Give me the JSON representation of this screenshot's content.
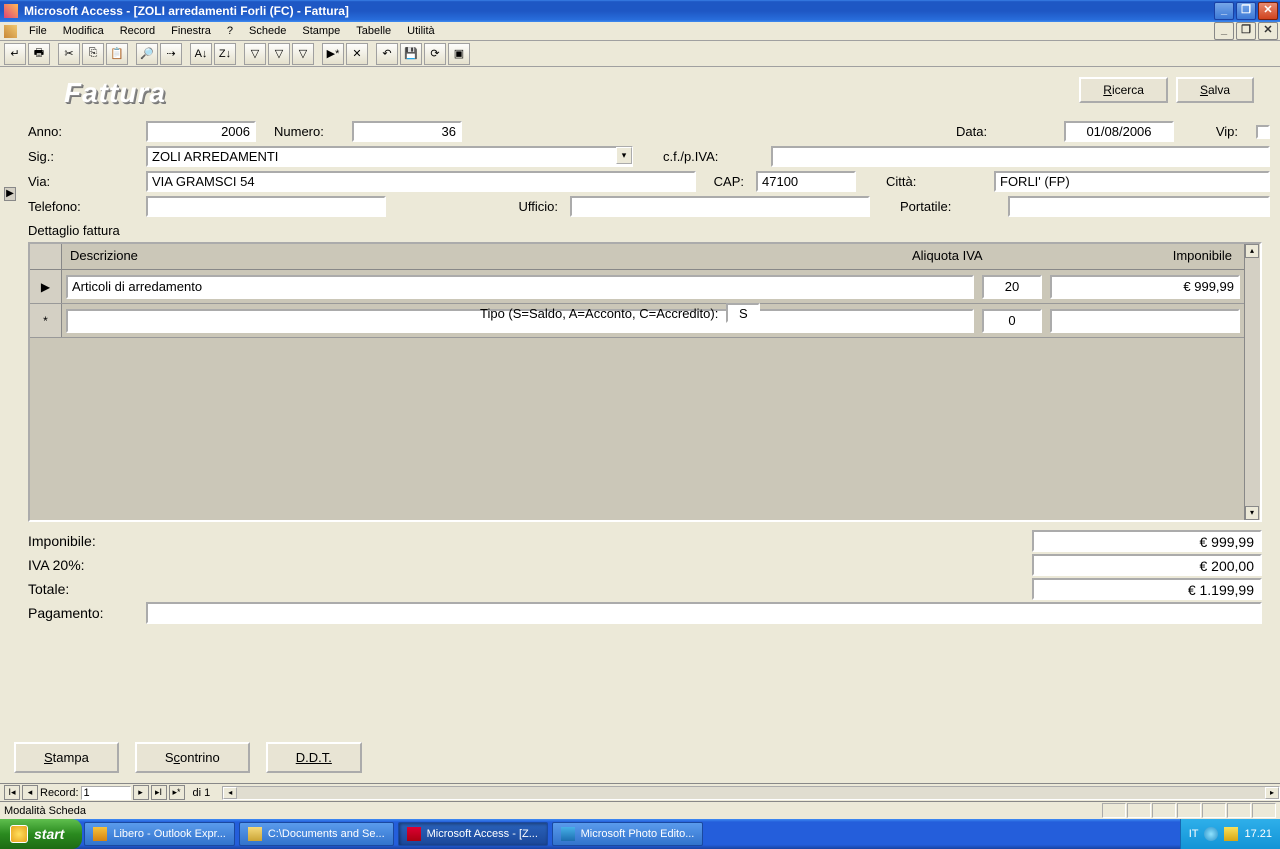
{
  "title": "Microsoft Access - [ZOLI arredamenti Forli (FC) - Fattura]",
  "menu": [
    "File",
    "Modifica",
    "Record",
    "Finestra",
    "?",
    "Schede",
    "Stampe",
    "Tabelle",
    "Utilità"
  ],
  "form": {
    "title": "Fattura",
    "buttons": {
      "ricerca": "Ricerca",
      "salva": "Salva"
    },
    "labels": {
      "anno": "Anno:",
      "numero": "Numero:",
      "data": "Data:",
      "vip": "Vip:",
      "sig": "Sig.:",
      "cfpiva": "c.f./p.IVA:",
      "via": "Via:",
      "cap": "CAP:",
      "citta": "Città:",
      "telefono": "Telefono:",
      "ufficio": "Ufficio:",
      "portatile": "Portatile:",
      "tipo": "Tipo (S=Saldo, A=Acconto, C=Accredito):",
      "dettaglio": "Dettaglio fattura"
    },
    "values": {
      "anno": "2006",
      "numero": "36",
      "data": "01/08/2006",
      "sig": "ZOLI ARREDAMENTI",
      "cfpiva": "",
      "via": "VIA GRAMSCI 54",
      "cap": "47100",
      "citta": "FORLI' (FP)",
      "telefono": "",
      "ufficio": "",
      "portatile": "",
      "tipo": "S"
    }
  },
  "detail": {
    "headers": {
      "descrizione": "Descrizione",
      "aliquota": "Aliquota IVA",
      "imponibile": "Imponibile"
    },
    "rows": [
      {
        "selector": "▶",
        "descrizione": "Articoli di arredamento",
        "iva": "20",
        "imponibile": "€ 999,99"
      },
      {
        "selector": "*",
        "descrizione": "",
        "iva": "0",
        "imponibile": ""
      }
    ]
  },
  "totals": {
    "imponibile_label": "Imponibile:",
    "imponibile": "€ 999,99",
    "iva_label": "IVA 20%:",
    "iva": "€ 200,00",
    "totale_label": "Totale:",
    "totale": "€ 1.199,99",
    "pagamento_label": "Pagamento:",
    "pagamento": ""
  },
  "bottom_buttons": {
    "stampa": "Stampa",
    "scontrino": "Scontrino",
    "ddt": "D.D.T."
  },
  "recnav": {
    "label": "Record:",
    "current": "1",
    "of": "di 1"
  },
  "status": "Modalità Scheda",
  "taskbar": {
    "start": "start",
    "tasks": [
      "Libero - Outlook Expr...",
      "C:\\Documents and Se...",
      "Microsoft Access - [Z...",
      "Microsoft Photo Edito..."
    ],
    "lang": "IT",
    "clock": "17.21"
  }
}
